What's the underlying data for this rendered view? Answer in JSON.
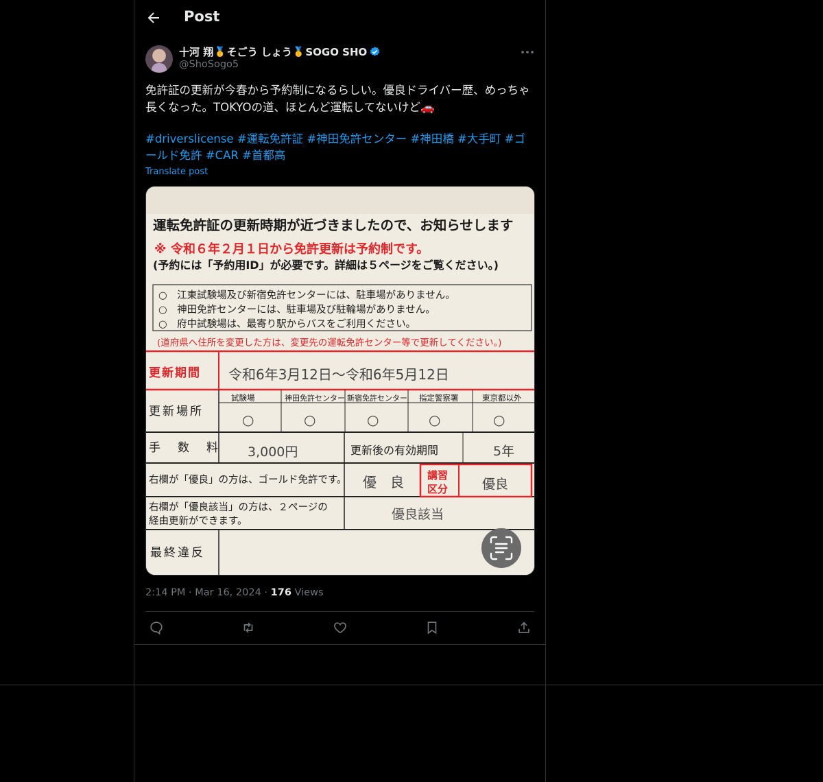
{
  "header": {
    "title": "Post"
  },
  "post": {
    "author_name": "十河 翔",
    "author_name_mid": "そごう しょう",
    "author_name_end": "SOGO SHO",
    "medal_1": "🥇",
    "medal_2": "🥇",
    "handle": "@ShoSogo5",
    "text": "免許証の更新が今春から予約制になるらしい。優良ドライバー歴、めっちゃ長くなった。TOKYOの道、ほとんど運転してないけど🚗",
    "hashtags": [
      "#driverslicense",
      "#運転免許証",
      "#神田免許センター",
      "#神田橋",
      "#大手町",
      "#ゴールド免許",
      "#CAR",
      "#首都高"
    ],
    "translate_label": "Translate post",
    "time": "2:14 PM",
    "dot": "·",
    "date": "Mar 16, 2024",
    "views_count": "176",
    "views_label": "Views"
  },
  "image_text": {
    "heading": "運転免許証の更新時期が近づきましたので、お知らせします",
    "notice_mark": "※",
    "notice": "令和６年２月１日から免許更新は予約制です。",
    "notice_sub": "(予約には「予約用ID」が必要です。詳細は５ページをご覧ください。)",
    "bullets": [
      "○　江東試験場及び新宿免許センターには、駐車場がありません。",
      "○　神田免許センターには、駐車場及び駐輪場がありません。",
      "○　府中試験場は、最寄り駅からバスをご利用ください。"
    ],
    "red_note": "(道府県へ住所を変更した方は、変更先の運転免許センター等で更新してください。)",
    "period_label": "更新期間",
    "period_value": "令和6年3月12日～令和6年5月12日",
    "place_label": "更新場所",
    "place_cols": [
      "試験場",
      "神田免許センター",
      "新宿免許センター",
      "指定警察署",
      "東京都以外"
    ],
    "circle": "○",
    "fee_label": "手　数　料",
    "fee_value": "3,000円",
    "valid_label": "更新後の有効期間",
    "valid_value": "5年",
    "gold_label": "右欄が「優良」の方は、ゴールド免許です。",
    "gold_value": "優　良",
    "lecture_label_1": "講習",
    "lecture_label_2": "区分",
    "lecture_value": "優良",
    "route_label_1": "右欄が「優良該当」の方は、２ページの",
    "route_label_2": "経由更新ができます。",
    "route_value": "優良該当",
    "violation_label": "最終違反"
  },
  "colors": {
    "accent": "#1d9bf0",
    "muted": "#71767b",
    "form_red": "#e0262a"
  }
}
